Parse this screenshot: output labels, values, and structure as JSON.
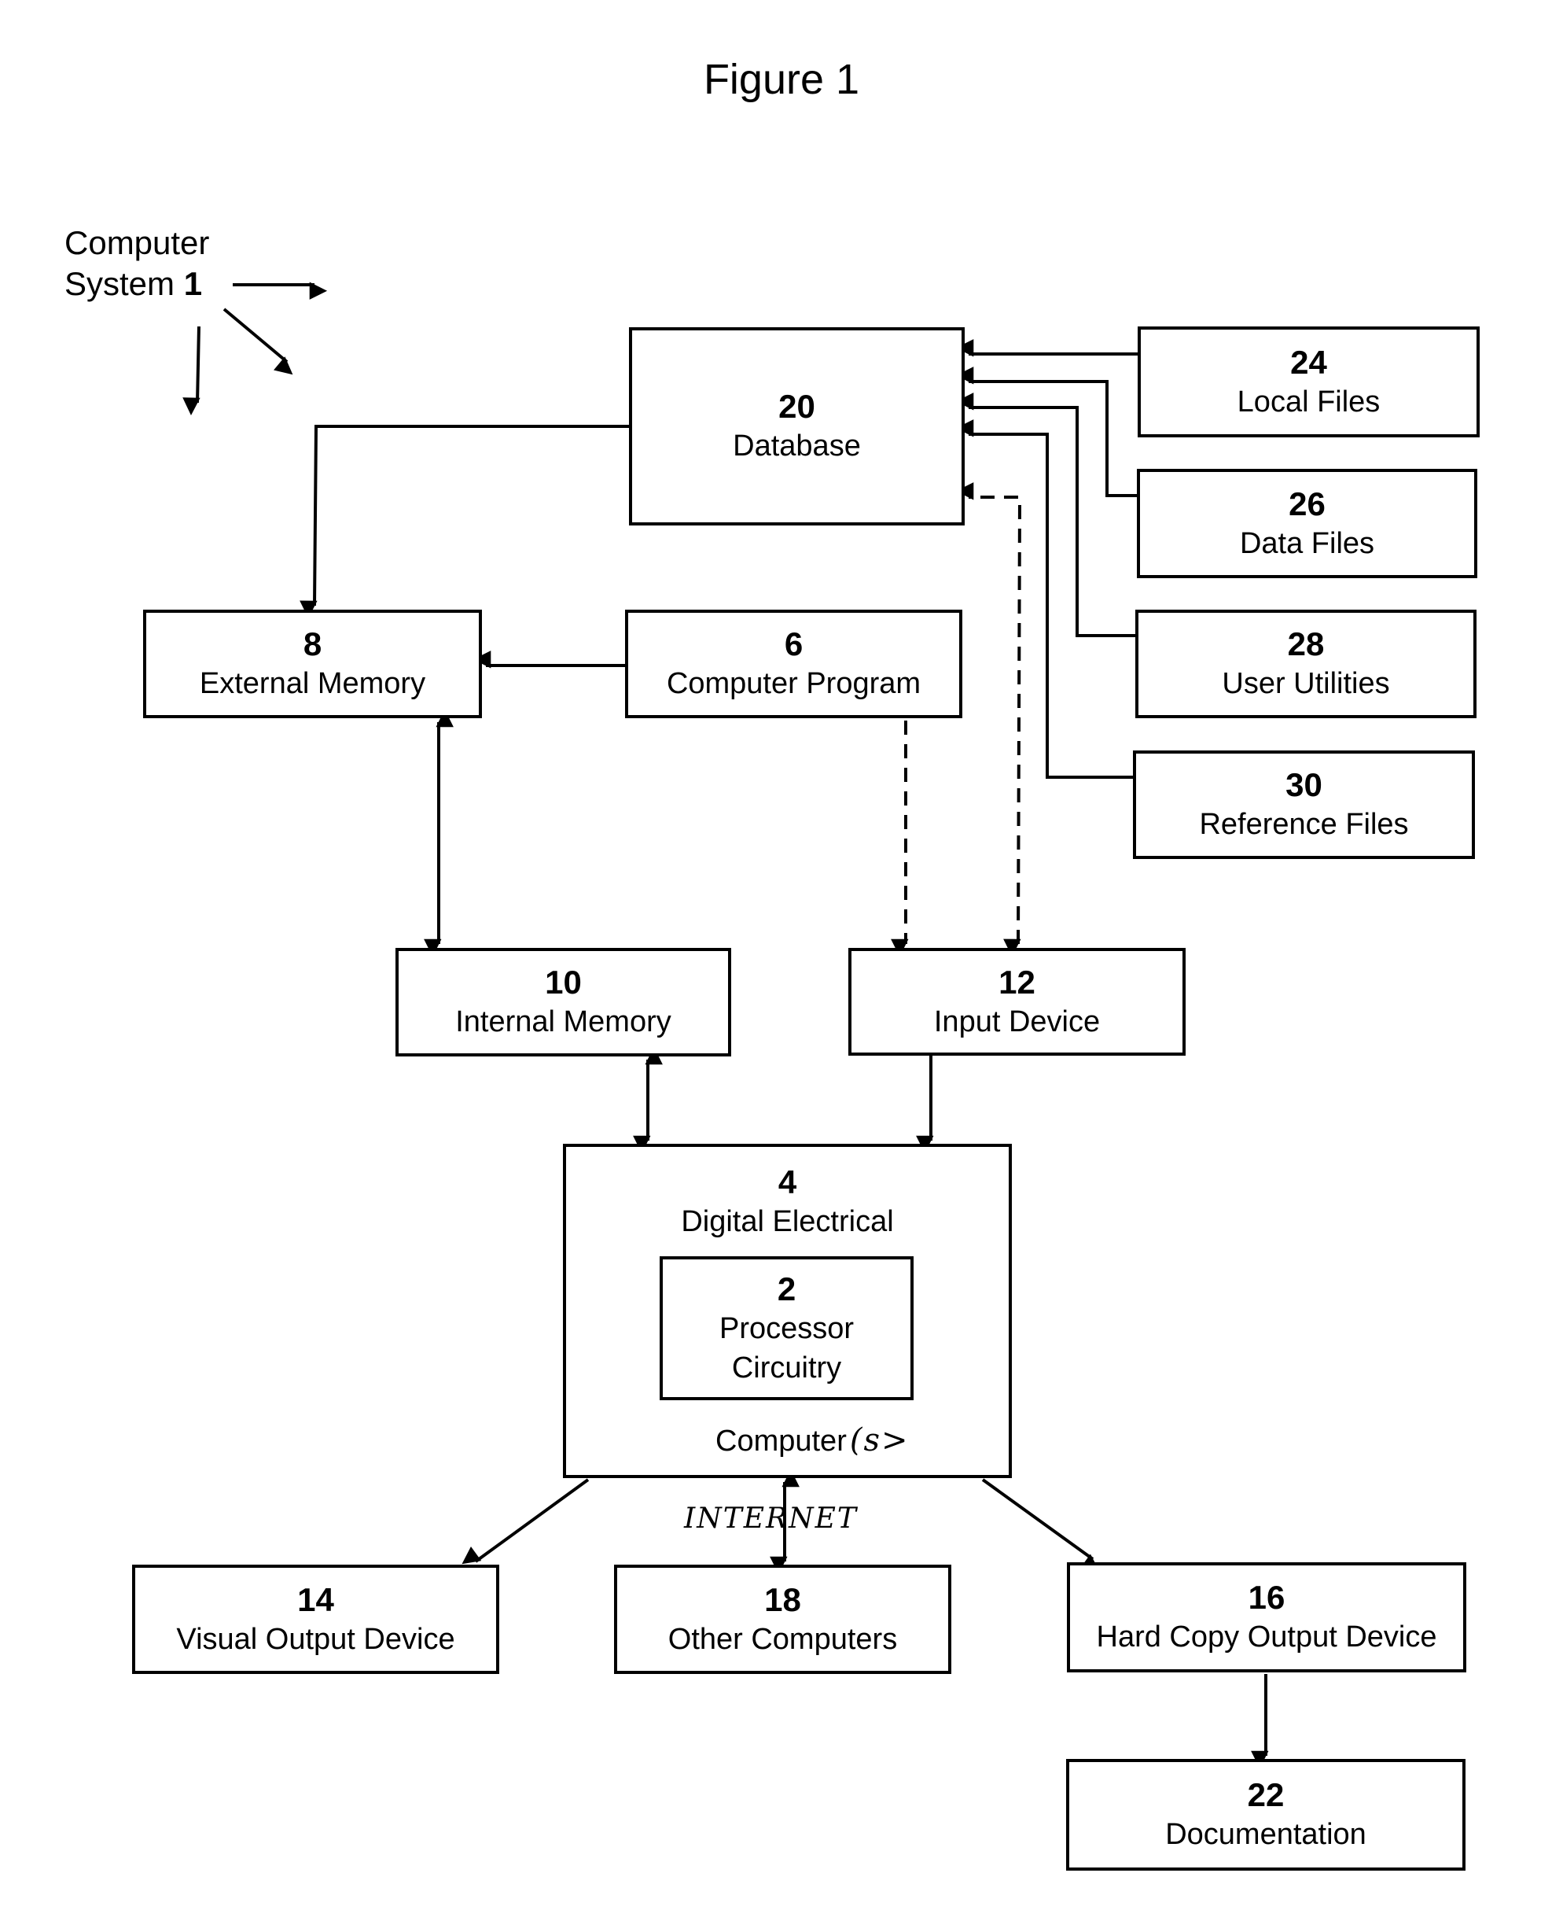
{
  "figure": {
    "title": "Figure 1",
    "system_label_line1": "Computer",
    "system_label_line2": "System",
    "system_number": "1"
  },
  "boxes": {
    "database": {
      "num": "20",
      "label": "Database"
    },
    "local_files": {
      "num": "24",
      "label": "Local Files"
    },
    "data_files": {
      "num": "26",
      "label": "Data Files"
    },
    "user_utilities": {
      "num": "28",
      "label": "User Utilities"
    },
    "reference_files": {
      "num": "30",
      "label": "Reference Files"
    },
    "external_memory": {
      "num": "8",
      "label": "External Memory"
    },
    "computer_program": {
      "num": "6",
      "label": "Computer Program"
    },
    "internal_memory": {
      "num": "10",
      "label": "Internal Memory"
    },
    "input_device": {
      "num": "12",
      "label": "Input Device"
    },
    "digital_electrical": {
      "num": "4",
      "label": "Digital Electrical",
      "footer": "Computer",
      "footer_handwritten": "(s>"
    },
    "processor": {
      "num": "2",
      "label_line1": "Processor",
      "label_line2": "Circuitry"
    },
    "visual_output": {
      "num": "14",
      "label": "Visual Output Device"
    },
    "other_computers": {
      "num": "18",
      "label": "Other Computers"
    },
    "hard_copy_output": {
      "num": "16",
      "label": "Hard Copy Output Device"
    },
    "documentation": {
      "num": "22",
      "label": "Documentation"
    }
  },
  "annotations": {
    "internet_handwritten": "INTERNET"
  },
  "connections": [
    {
      "from": "24",
      "to": "20",
      "style": "solid"
    },
    {
      "from": "26",
      "to": "20",
      "style": "solid"
    },
    {
      "from": "28",
      "to": "20",
      "style": "solid"
    },
    {
      "from": "30",
      "to": "20",
      "style": "solid"
    },
    {
      "from": "20",
      "to": "8",
      "style": "solid"
    },
    {
      "from": "6",
      "to": "8",
      "style": "solid"
    },
    {
      "from": "8",
      "to": "10",
      "style": "solid",
      "bidirectional": true
    },
    {
      "from": "6",
      "to": "12",
      "style": "dashed"
    },
    {
      "from": "12",
      "to": "20",
      "style": "dashed",
      "bidirectional": true
    },
    {
      "from": "10",
      "to": "4",
      "style": "solid",
      "bidirectional": true
    },
    {
      "from": "12",
      "to": "4",
      "style": "solid"
    },
    {
      "from": "4",
      "to": "14",
      "style": "solid"
    },
    {
      "from": "4",
      "to": "18",
      "style": "solid",
      "bidirectional": true,
      "label": "INTERNET"
    },
    {
      "from": "4",
      "to": "16",
      "style": "solid"
    },
    {
      "from": "16",
      "to": "22",
      "style": "solid"
    }
  ]
}
